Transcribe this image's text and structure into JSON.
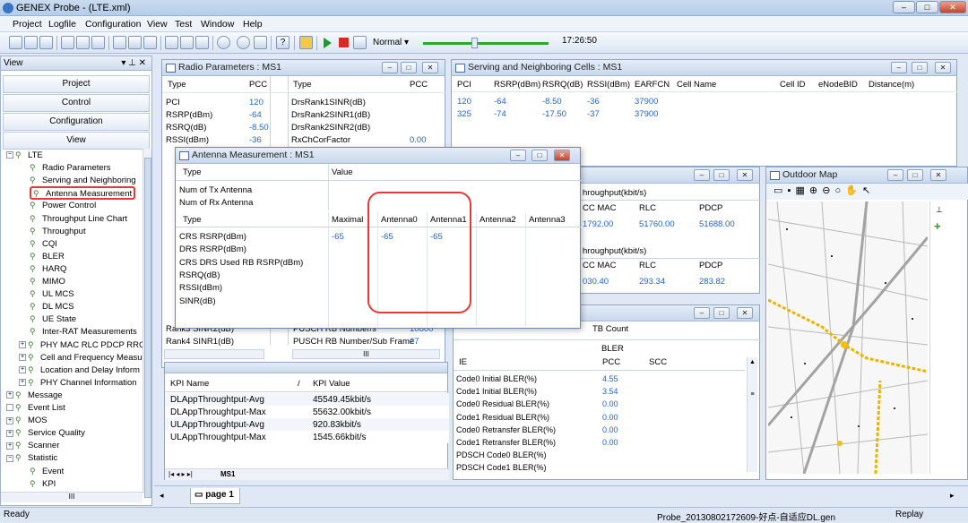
{
  "window": {
    "title": "GENEX Probe - (LTE.xml)",
    "min": "–",
    "max": "□",
    "close": "✕"
  },
  "menu": [
    "Project",
    "Logfile",
    "Configuration",
    "View",
    "Test",
    "Window",
    "Help"
  ],
  "toolbar": {
    "mode": "Normal",
    "time": "17:26:50"
  },
  "left_panel": {
    "title": "View",
    "pin": "▾ ⊥ ✕",
    "nav": [
      "Project",
      "Control",
      "Configuration",
      "View"
    ],
    "tree": [
      {
        "label": "LTE",
        "indent": 0,
        "expander": "−"
      },
      {
        "label": "Radio Parameters",
        "indent": 2
      },
      {
        "label": "Serving and Neighboring",
        "indent": 2
      },
      {
        "label": "Antenna Measurement",
        "indent": 2,
        "highlight": true
      },
      {
        "label": "Power Control",
        "indent": 2
      },
      {
        "label": "Throughput Line Chart",
        "indent": 2
      },
      {
        "label": "Throughput",
        "indent": 2
      },
      {
        "label": "CQI",
        "indent": 2
      },
      {
        "label": "BLER",
        "indent": 2
      },
      {
        "label": "HARQ",
        "indent": 2
      },
      {
        "label": "MIMO",
        "indent": 2
      },
      {
        "label": "UL MCS",
        "indent": 2
      },
      {
        "label": "DL MCS",
        "indent": 2
      },
      {
        "label": "UE State",
        "indent": 2
      },
      {
        "label": "Inter-RAT Measurements",
        "indent": 2
      },
      {
        "label": "PHY MAC RLC PDCP RRC I",
        "indent": 1,
        "expander": "+"
      },
      {
        "label": "Cell and Frequency Measu",
        "indent": 1,
        "expander": "+"
      },
      {
        "label": "Location and Delay Inform",
        "indent": 1,
        "expander": "+"
      },
      {
        "label": "PHY Channel Information",
        "indent": 1,
        "expander": "+"
      },
      {
        "label": "Message",
        "indent": 0,
        "expander": "+"
      },
      {
        "label": "Event List",
        "indent": 0,
        "expander": ""
      },
      {
        "label": "MOS",
        "indent": 0,
        "expander": "+"
      },
      {
        "label": "Service Quality",
        "indent": 0,
        "expander": "+"
      },
      {
        "label": "Scanner",
        "indent": 0,
        "expander": "+"
      },
      {
        "label": "Statistic",
        "indent": 0,
        "expander": "−"
      },
      {
        "label": "Event",
        "indent": 2
      },
      {
        "label": "KPI",
        "indent": 2
      }
    ]
  },
  "radio_params": {
    "title": "Radio Parameters : MS1",
    "cols": [
      "Type",
      "PCC",
      "Type",
      "PCC"
    ],
    "left_rows": [
      [
        "PCI",
        "120"
      ],
      [
        "RSRP(dBm)",
        "-64"
      ],
      [
        "RSRQ(dB)",
        "-8.50"
      ],
      [
        "RSSI(dBm)",
        "-36"
      ]
    ],
    "right_rows": [
      [
        "DrsRank1SINR(dB)",
        ""
      ],
      [
        "DrsRank2SINR1(dB)",
        ""
      ],
      [
        "DrsRank2SINR2(dB)",
        ""
      ],
      [
        "RxChCorFactor",
        "0.00"
      ]
    ],
    "bottom_left": [
      "Rank3 SINR2(dB)",
      "Rank4 SINR1(dB)"
    ],
    "bottom_right": [
      [
        "PUSCH RB Number/s",
        "10800"
      ],
      [
        "PUSCH RB Number/Sub Frame",
        "27"
      ]
    ],
    "scroll": "III"
  },
  "serving": {
    "title": "Serving and Neighboring Cells : MS1",
    "cols": [
      "PCI",
      "RSRP(dBm)",
      "RSRQ(dB)",
      "RSSI(dBm)",
      "EARFCN",
      "Cell Name",
      "Cell ID",
      "eNodeBID",
      "Distance(m)"
    ],
    "rows": [
      [
        "120",
        "-64",
        "-8.50",
        "-36",
        "37900"
      ],
      [
        "325",
        "-74",
        "-17.50",
        "-37",
        "37900"
      ]
    ]
  },
  "antenna": {
    "title": "Antenna Measurement : MS1",
    "top_cols": [
      "Type",
      "Value"
    ],
    "top_rows": [
      "Num of Tx Antenna",
      "Num of Rx Antenna"
    ],
    "cols": [
      "Type",
      "Maximal",
      "Antenna0",
      "Antenna1",
      "Antenna2",
      "Antenna3"
    ],
    "rows": [
      [
        "CRS RSRP(dBm)",
        "-65",
        "-65",
        "-65"
      ],
      [
        "DRS RSRP(dBm)",
        "",
        "",
        ""
      ],
      [
        "CRS DRS Used RB RSRP(dBm)",
        "",
        "",
        ""
      ],
      [
        "RSRQ(dB)",
        "",
        "",
        ""
      ],
      [
        "RSSI(dBm)",
        "",
        "",
        ""
      ],
      [
        "SINR(dB)",
        "",
        "",
        ""
      ]
    ]
  },
  "throughput": {
    "h1": "hroughput(kbit/s)",
    "c1": [
      "CC MAC",
      "RLC",
      "PDCP"
    ],
    "v1": [
      "1792.00",
      "51760.00",
      "51688.00"
    ],
    "h2": "hroughput(kbit/s)",
    "c2": [
      "CC MAC",
      "RLC",
      "PDCP"
    ],
    "v2": [
      "030.40",
      "293.34",
      "283.82"
    ]
  },
  "kpi": {
    "cols": [
      "KPI Name",
      "KPI Value"
    ],
    "sort": "/",
    "rows": [
      [
        "DLAppThroughtput-Avg",
        "45549.45kbit/s"
      ],
      [
        "DLAppThroughtput-Max",
        "55632.00kbit/s"
      ],
      [
        "ULAppThroughtput-Avg",
        "920.83kbit/s"
      ],
      [
        "ULAppThroughtput-Max",
        "1545.66kbit/s"
      ]
    ],
    "tab": "MS1"
  },
  "bler": {
    "tb_count": "TB Count",
    "bler": "BLER",
    "cols": [
      "IE",
      "PCC",
      "SCC"
    ],
    "rows": [
      [
        "Code0 Initial BLER(%)",
        "4.55"
      ],
      [
        "Code1 Initial BLER(%)",
        "3.54"
      ],
      [
        "Code0 Residual BLER(%)",
        "0.00"
      ],
      [
        "Code1 Residual BLER(%)",
        "0.00"
      ],
      [
        "Code0 Retransfer BLER(%)",
        "0.00"
      ],
      [
        "Code1 Retransfer BLER(%)",
        "0.00"
      ],
      [
        "PDSCH Code0 BLER(%)",
        ""
      ],
      [
        "PDSCH Code1 BLER(%)",
        ""
      ]
    ]
  },
  "map": {
    "title": "Outdoor Map",
    "panel_pin": "⊥"
  },
  "tabs": {
    "page": "page 1"
  },
  "status": {
    "left": "Ready",
    "file": "Probe_20130802172609-好点-自适应DL.gen",
    "mode": "Replay"
  },
  "colors": {
    "highlight": "#e03a3a",
    "value_blue": "#1f64c8"
  }
}
